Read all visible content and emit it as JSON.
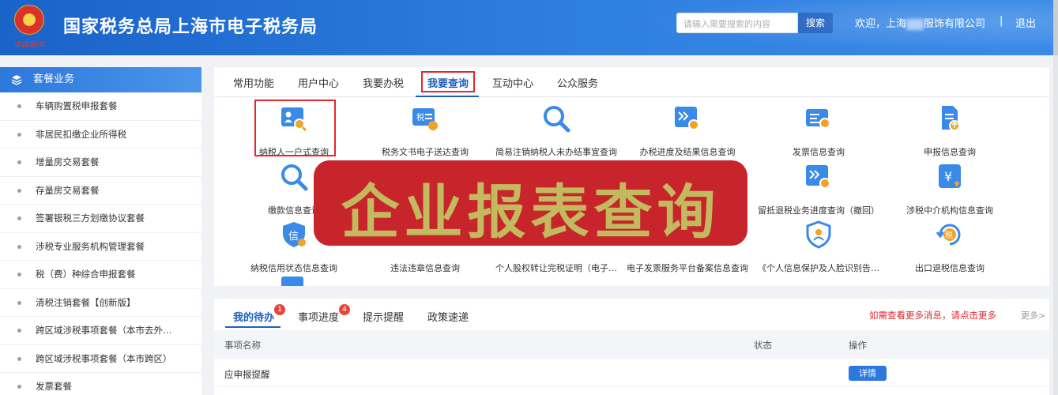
{
  "header": {
    "logo_text": "中国税务",
    "title": "国家税务总局上海市电子税务局",
    "search_placeholder": "请输入需要搜索的内容",
    "search_button": "搜索",
    "welcome_prefix": "欢迎，上海",
    "welcome_suffix": "服饰有限公司",
    "separator": "|",
    "logout": "退出"
  },
  "sidebar": {
    "title": "套餐业务",
    "items": [
      {
        "label": "车辆购置税申报套餐"
      },
      {
        "label": "非居民扣缴企业所得税"
      },
      {
        "label": "增量房交易套餐"
      },
      {
        "label": "存量房交易套餐"
      },
      {
        "label": "签署银税三方划缴协议套餐"
      },
      {
        "label": "涉税专业服务机构管理套餐"
      },
      {
        "label": "税（费）种综合申报套餐"
      },
      {
        "label": "清税注销套餐【创新版】"
      },
      {
        "label": "跨区域涉税事项套餐（本市去外…"
      },
      {
        "label": "跨区域涉税事项套餐（本市跨区）"
      },
      {
        "label": "发票套餐"
      }
    ]
  },
  "main_tabs": [
    {
      "label": "常用功能"
    },
    {
      "label": "用户中心"
    },
    {
      "label": "我要办税"
    },
    {
      "label": "我要查询"
    },
    {
      "label": "互动中心"
    },
    {
      "label": "公众服务"
    }
  ],
  "functions": [
    {
      "label": "纳税人一户式查询",
      "icon": "taxpayer-search-icon"
    },
    {
      "label": "税务文书电子送达查询",
      "icon": "tax-document-icon"
    },
    {
      "label": "简易注销纳税人未办结事宜查询",
      "icon": "magnifier-icon"
    },
    {
      "label": "办税进度及结果信息查询",
      "icon": "progress-search-icon"
    },
    {
      "label": "发票信息查询",
      "icon": "invoice-search-icon"
    },
    {
      "label": "申报信息查询",
      "icon": "declaration-upload-icon"
    },
    {
      "label": "缴款信息查询",
      "icon": "magnifier-icon"
    },
    {
      "label": "留抵退税业务进度查询（撤回）",
      "icon": "progress-search-icon"
    },
    {
      "label": "涉税中介机构信息查询",
      "icon": "yuan-agency-icon"
    },
    {
      "label": "纳税信用状态信息查询",
      "icon": "credit-shield-icon"
    },
    {
      "label": "违法违章信息查询",
      "icon": "violation-icon"
    },
    {
      "label": "个人股权转让完税证明（电子…",
      "icon": "equity-icon"
    },
    {
      "label": "电子发票服务平台备案信息查询",
      "icon": "e-invoice-icon"
    },
    {
      "label": "《个人信息保护及人脸识别告…",
      "icon": "privacy-shield-icon"
    },
    {
      "label": "出口退税信息查询",
      "icon": "tax-refund-icon"
    }
  ],
  "overlay_banner": "企业报表查询",
  "bottom": {
    "tabs": [
      {
        "label": "我的待办",
        "badge": "1"
      },
      {
        "label": "事项进度",
        "badge": "4"
      },
      {
        "label": "提示提醒",
        "badge": ""
      },
      {
        "label": "政策速递",
        "badge": ""
      }
    ],
    "notice": "如需查看更多消息，请点击更多",
    "more": "更多>",
    "columns": [
      "事项名称",
      "状态",
      "操作"
    ],
    "rows": [
      {
        "name": "应申报提醒",
        "status": "",
        "action": "详情"
      }
    ]
  },
  "colors": {
    "header_blue": "#2f7fe0",
    "accent_blue": "#1e5fc0",
    "highlight_red": "#e5262b",
    "banner_red": "#c8242c",
    "banner_text": "#c3b95e"
  }
}
